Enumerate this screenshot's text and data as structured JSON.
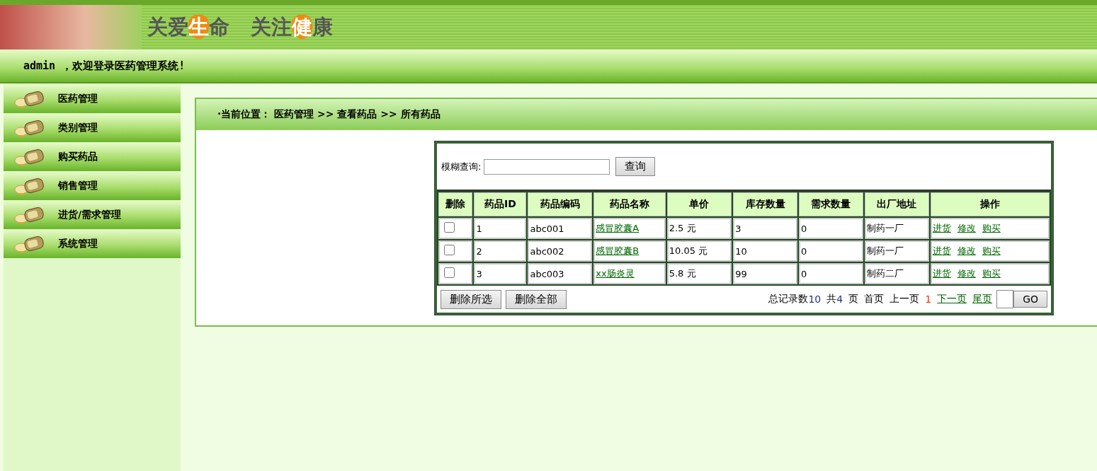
{
  "banner": {
    "slogan": [
      {
        "before": "关爱",
        "highlight": "生",
        "after": "命"
      },
      {
        "before": "关注",
        "highlight": "健",
        "after": "康"
      }
    ]
  },
  "welcome": "admin ，欢迎登录医药管理系统!",
  "sidebar": {
    "items": [
      {
        "label": "医药管理"
      },
      {
        "label": "类别管理"
      },
      {
        "label": "购买药品"
      },
      {
        "label": "销售管理"
      },
      {
        "label": "进货/需求管理"
      },
      {
        "label": "系统管理"
      }
    ]
  },
  "breadcrumb": "·当前位置： 医药管理 >> 查看药品 >> 所有药品",
  "search": {
    "label": "模糊查询:",
    "button": "查询"
  },
  "table": {
    "columns": [
      "删除",
      "药品ID",
      "药品编码",
      "药品名称",
      "单价",
      "库存数量",
      "需求数量",
      "出厂地址",
      "操作"
    ],
    "rows": [
      {
        "checked": false,
        "id": "1",
        "code": "abc001",
        "name": "感冒胶囊A",
        "price": "2.5 元",
        "stock": "3",
        "demand": "0",
        "factory": "制药一厂",
        "actions": [
          "进货",
          "修改",
          "购买"
        ]
      },
      {
        "checked": false,
        "id": "2",
        "code": "abc002",
        "name": "感冒胶囊B",
        "price": "10.05 元",
        "stock": "10",
        "demand": "0",
        "factory": "制药一厂",
        "actions": [
          "进货",
          "修改",
          "购买"
        ]
      },
      {
        "checked": false,
        "id": "3",
        "code": "abc003",
        "name": "xx肠炎灵",
        "price": "5.8 元",
        "stock": "99",
        "demand": "0",
        "factory": "制药二厂",
        "actions": [
          "进货",
          "修改",
          "购买"
        ]
      }
    ]
  },
  "footer_buttons": [
    "删除所选",
    "删除全部"
  ],
  "pagination": [
    {
      "kind": "text",
      "text": "总记录数"
    },
    {
      "kind": "number",
      "text": "10"
    },
    {
      "kind": "text",
      "text": "共"
    },
    {
      "kind": "number",
      "text": "4"
    },
    {
      "kind": "text",
      "text": "页"
    },
    {
      "kind": "text",
      "text": "首页"
    },
    {
      "kind": "text",
      "text": "上一页"
    },
    {
      "kind": "current",
      "text": "1"
    },
    {
      "kind": "link",
      "text": "下一页"
    },
    {
      "kind": "link",
      "text": "尾页"
    }
  ],
  "go_button": "GO"
}
